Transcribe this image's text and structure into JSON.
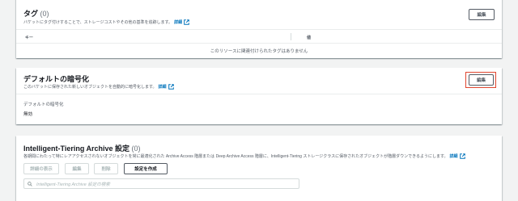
{
  "tags": {
    "title": "タグ",
    "count": "(0)",
    "description": "バケットにタグ付けすることで、ストレージコストやその他の基準を追跡します。",
    "info_link": "詳細",
    "edit_button": "編集",
    "col_key": "キー",
    "col_value": "値",
    "empty_message": "このリソースに関連付けられたタグはありません"
  },
  "encryption": {
    "title": "デフォルトの暗号化",
    "description": "このバケットに保存された新しいオブジェクトを自動的に暗号化します。",
    "info_link": "詳細",
    "edit_button": "編集",
    "field_label": "デフォルトの暗号化",
    "field_value": "無効"
  },
  "intelligent_tiering": {
    "title": "Intelligent-Tiering Archive 設定",
    "count": "(0)",
    "description": "各期間にわたって特にレアアクセスされないオブジェクトを常に最適化された Archive Access 階層または Deep Archive Access 階層に、Intelligent-Tiering ストレージクラスに保存されたオブジェクトが階層ダウンできるようにします。",
    "info_link": "詳細",
    "buttons": {
      "view_details": "詳細の表示",
      "edit": "編集",
      "delete": "削除",
      "create": "設定を作成"
    },
    "search_placeholder": "Intelligent-Tiering Archive 設定の検索"
  },
  "colors": {
    "link": "#0073bb",
    "highlight": "#e0462f",
    "background": "#f2f3f3"
  }
}
